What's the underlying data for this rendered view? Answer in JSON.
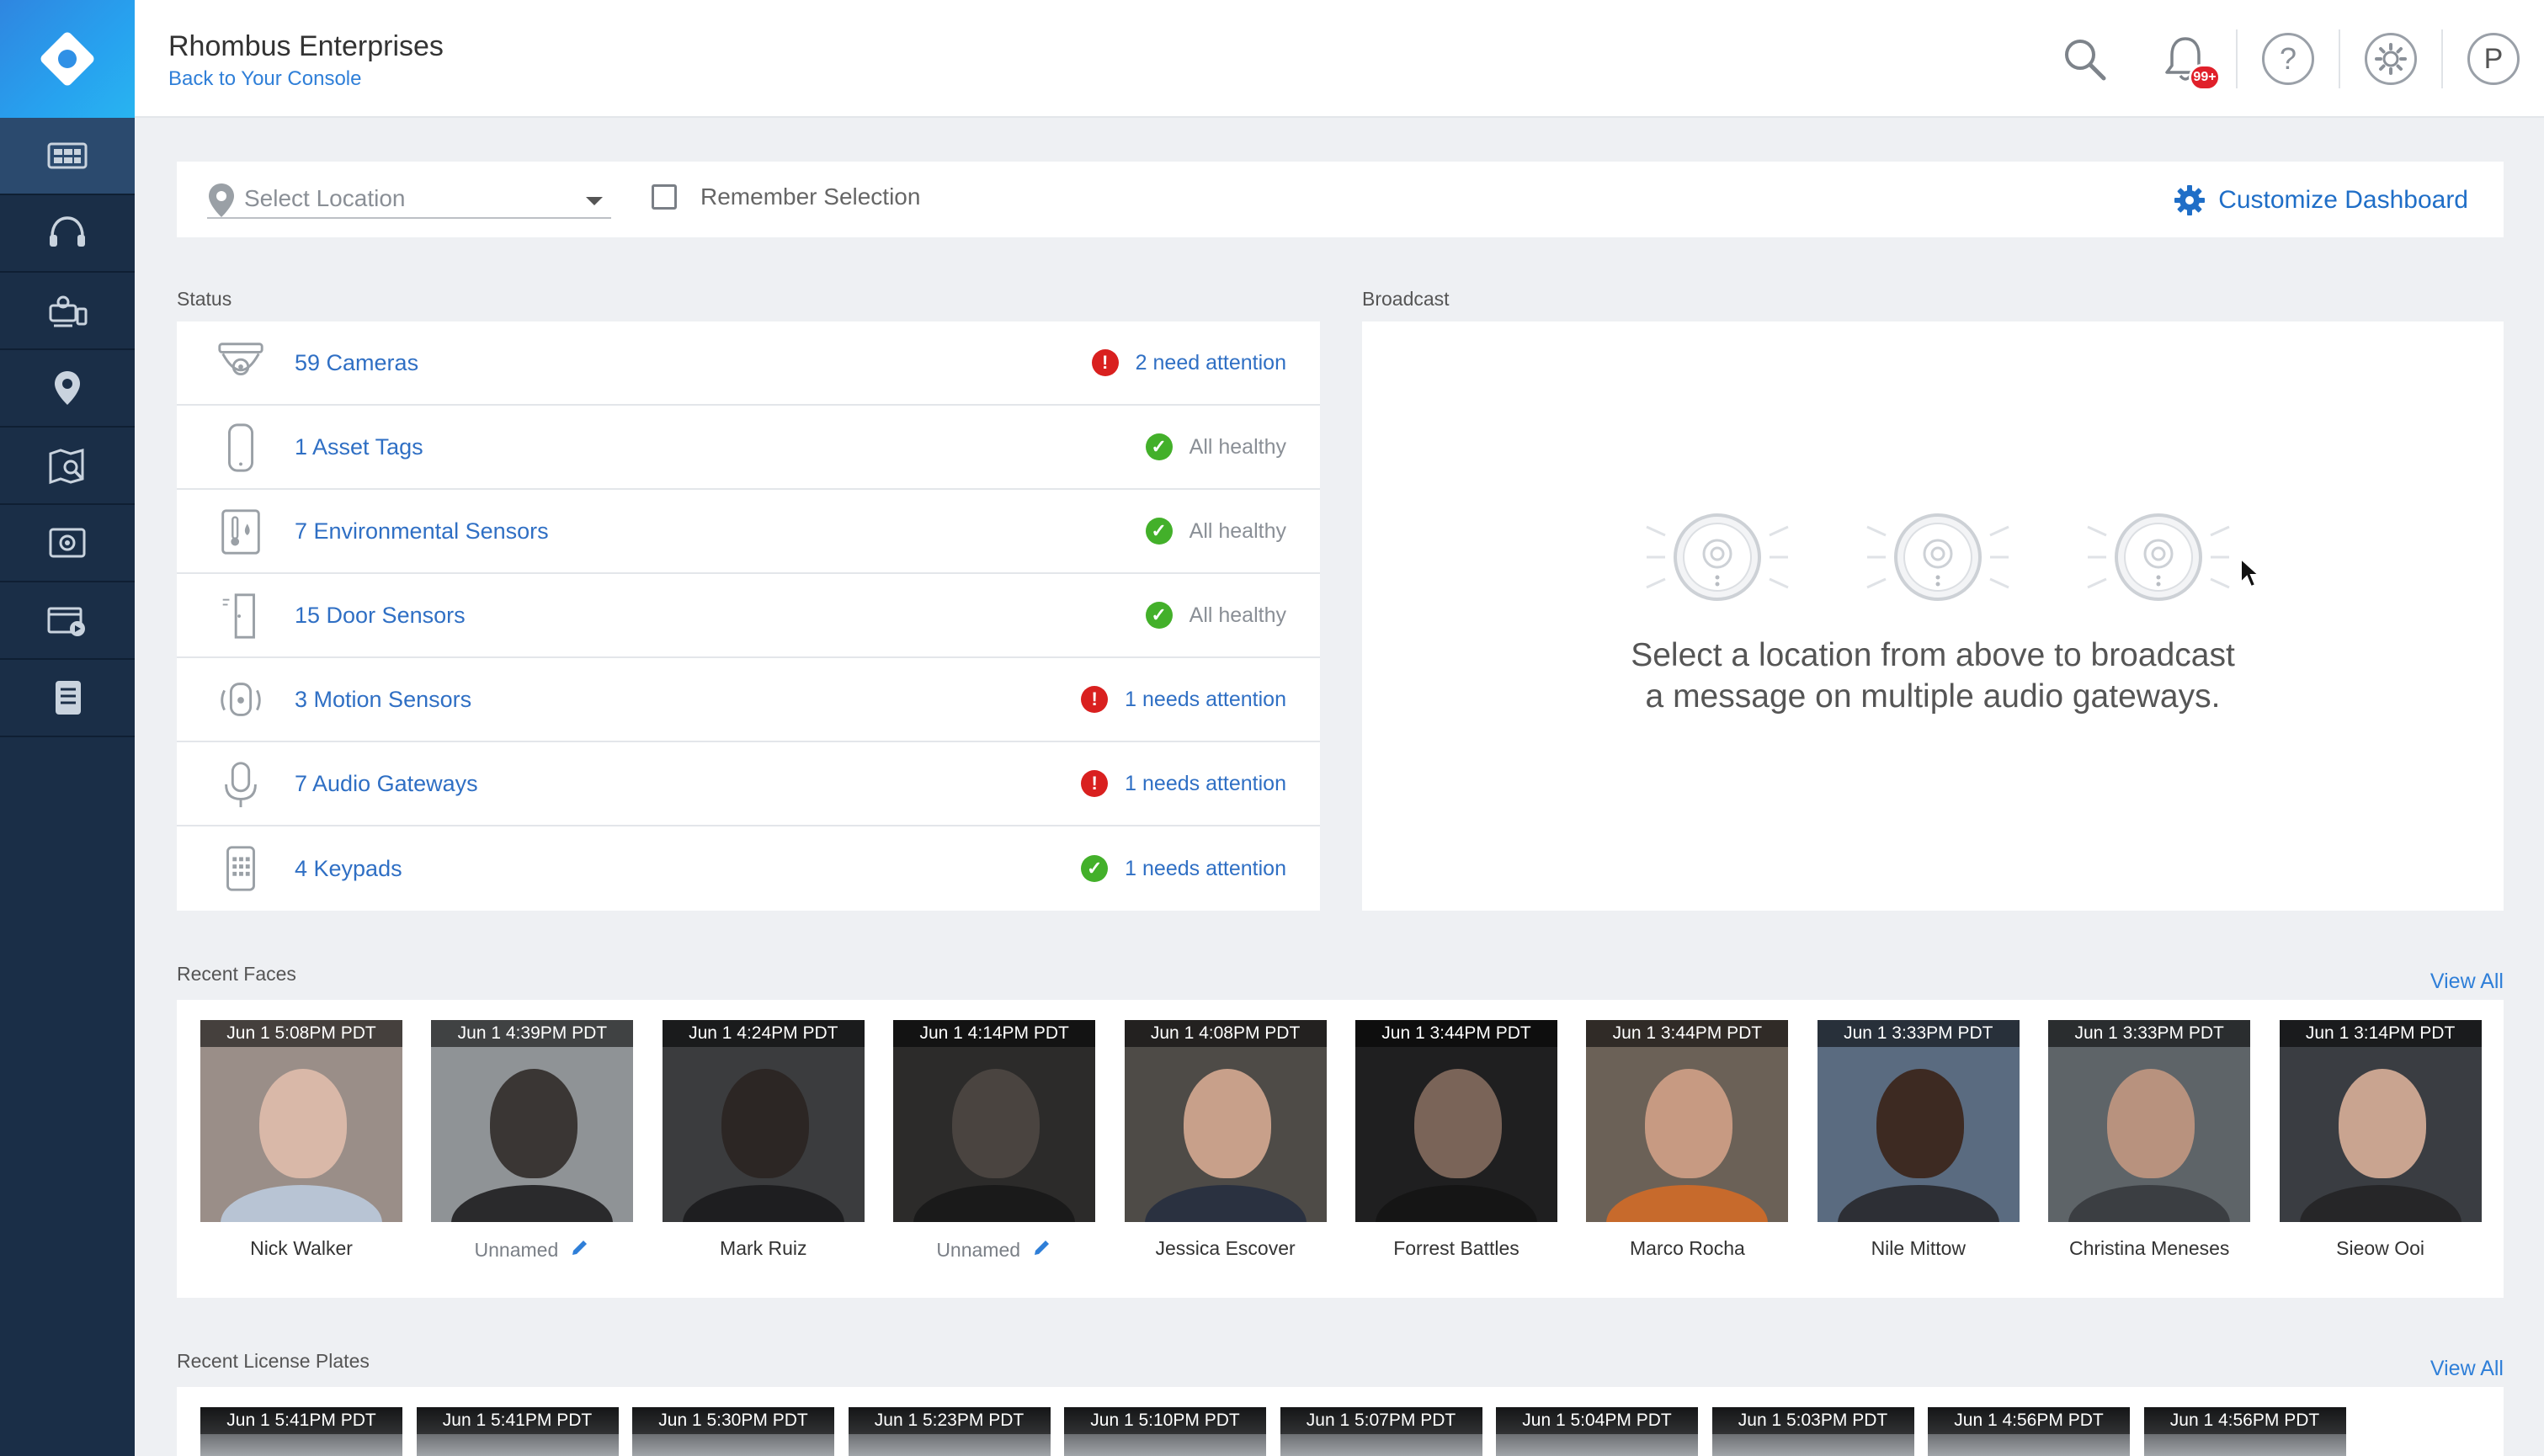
{
  "header": {
    "org_name": "Rhombus Enterprises",
    "back_link": "Back to Your Console",
    "notification_badge": "99+",
    "avatar_initial": "P",
    "help_glyph": "?"
  },
  "sidebar": {
    "items": [
      {
        "icon": "dashboard-icon",
        "active": true
      },
      {
        "icon": "headset-icon",
        "active": false
      },
      {
        "icon": "devices-icon",
        "active": false
      },
      {
        "icon": "location-pin-icon",
        "active": false
      },
      {
        "icon": "map-search-icon",
        "active": false
      },
      {
        "icon": "camera-view-icon",
        "active": false
      },
      {
        "icon": "video-clips-icon",
        "active": false
      },
      {
        "icon": "reports-icon",
        "active": false
      }
    ]
  },
  "location_bar": {
    "placeholder": "Select Location",
    "remember_label": "Remember Selection",
    "customize_label": "Customize Dashboard"
  },
  "status": {
    "label": "Status",
    "rows": [
      {
        "name": "59 Cameras",
        "state": "bad",
        "text": "2 need attention",
        "icon": "camera-icon"
      },
      {
        "name": "1 Asset Tags",
        "state": "good",
        "text": "All healthy",
        "icon": "asset-tag-icon"
      },
      {
        "name": "7 Environmental Sensors",
        "state": "good",
        "text": "All healthy",
        "icon": "environmental-sensor-icon"
      },
      {
        "name": "15 Door Sensors",
        "state": "good",
        "text": "All healthy",
        "icon": "door-sensor-icon"
      },
      {
        "name": "3 Motion Sensors",
        "state": "bad",
        "text": "1 needs attention",
        "icon": "motion-sensor-icon"
      },
      {
        "name": "7 Audio Gateways",
        "state": "bad",
        "text": "1 needs attention",
        "icon": "microphone-icon"
      },
      {
        "name": "4 Keypads",
        "state": "good",
        "text": "1 needs attention",
        "icon": "keypad-icon"
      }
    ]
  },
  "broadcast": {
    "label": "Broadcast",
    "message_line1": "Select a location from above to broadcast",
    "message_line2": "a message on multiple audio gateways."
  },
  "recent_faces": {
    "label": "Recent Faces",
    "view_all": "View All",
    "items": [
      {
        "time": "Jun 1 5:08PM PDT",
        "name": "Nick Walker",
        "unnamed": false,
        "bg": "#9a8e88",
        "skin": "#d9b8a8",
        "shirt": "#b8c4d4"
      },
      {
        "time": "Jun 1 4:39PM PDT",
        "name": "Unnamed",
        "unnamed": true,
        "bg": "#8f9396",
        "skin": "#3a3634",
        "shirt": "#2a2a2c"
      },
      {
        "time": "Jun 1 4:24PM PDT",
        "name": "Mark Ruiz",
        "unnamed": false,
        "bg": "#3b3c3e",
        "skin": "#2c2624",
        "shirt": "#1e1e20"
      },
      {
        "time": "Jun 1 4:14PM PDT",
        "name": "Unnamed",
        "unnamed": true,
        "bg": "#2c2b2a",
        "skin": "#4a4440",
        "shirt": "#1a1a1a"
      },
      {
        "time": "Jun 1 4:08PM PDT",
        "name": "Jessica Escover",
        "unnamed": false,
        "bg": "#4e4b47",
        "skin": "#c8a08a",
        "shirt": "#2a3140"
      },
      {
        "time": "Jun 1 3:44PM PDT",
        "name": "Forrest Battles",
        "unnamed": false,
        "bg": "#1f1f20",
        "skin": "#7a6458",
        "shirt": "#151515"
      },
      {
        "time": "Jun 1 3:44PM PDT",
        "name": "Marco Rocha",
        "unnamed": false,
        "bg": "#6b6157",
        "skin": "#c79a82",
        "shirt": "#c76a2c"
      },
      {
        "time": "Jun 1 3:33PM PDT",
        "name": "Nile Mittow",
        "unnamed": false,
        "bg": "#5a6b80",
        "skin": "#3d2a22",
        "shirt": "#2d2f35"
      },
      {
        "time": "Jun 1 3:33PM PDT",
        "name": "Christina Meneses",
        "unnamed": false,
        "bg": "#5e6468",
        "skin": "#b8927e",
        "shirt": "#3b3e42"
      },
      {
        "time": "Jun 1 3:14PM PDT",
        "name": "Sieow Ooi",
        "unnamed": false,
        "bg": "#3a3d42",
        "skin": "#c9a490",
        "shirt": "#262628"
      }
    ]
  },
  "recent_plates": {
    "label": "Recent License Plates",
    "view_all": "View All",
    "items": [
      {
        "time": "Jun 1 5:41PM PDT"
      },
      {
        "time": "Jun 1 5:41PM PDT"
      },
      {
        "time": "Jun 1 5:30PM PDT"
      },
      {
        "time": "Jun 1 5:23PM PDT"
      },
      {
        "time": "Jun 1 5:10PM PDT"
      },
      {
        "time": "Jun 1 5:07PM PDT"
      },
      {
        "time": "Jun 1 5:04PM PDT"
      },
      {
        "time": "Jun 1 5:03PM PDT"
      },
      {
        "time": "Jun 1 4:56PM PDT"
      },
      {
        "time": "Jun 1 4:56PM PDT"
      }
    ]
  },
  "colors": {
    "sidebar_bg": "#1a2e47",
    "accent": "#2f7fd8",
    "alert": "#d9201f",
    "healthy": "#43b02a"
  }
}
